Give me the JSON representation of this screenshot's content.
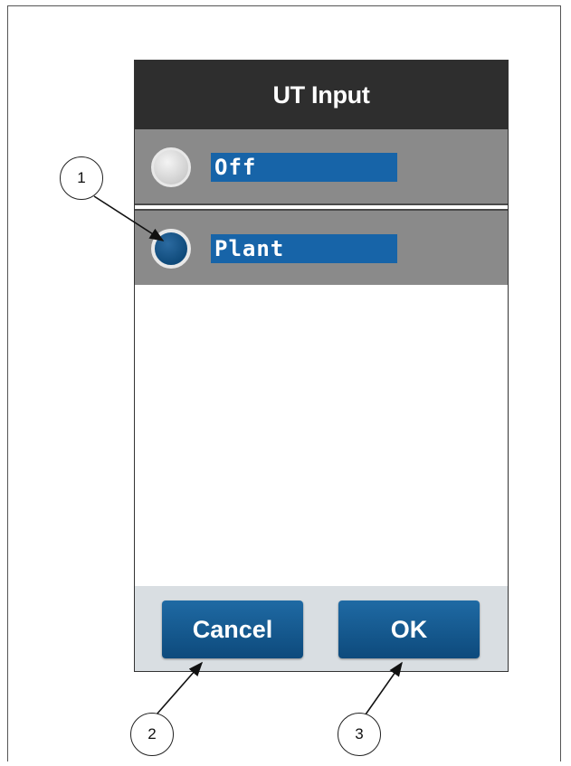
{
  "dialog": {
    "title": "UT Input",
    "options": [
      {
        "label": "Off",
        "selected": false
      },
      {
        "label": "Plant",
        "selected": true
      }
    ],
    "buttons": {
      "cancel_label": "Cancel",
      "ok_label": "OK"
    }
  },
  "callouts": [
    "1",
    "2",
    "3"
  ],
  "colors": {
    "title_bar": "#2e2e2e",
    "option_background": "#8a8a8a",
    "label_highlight": "#1764a8",
    "button": "#1a5e96",
    "footer": "#d9dee2"
  }
}
